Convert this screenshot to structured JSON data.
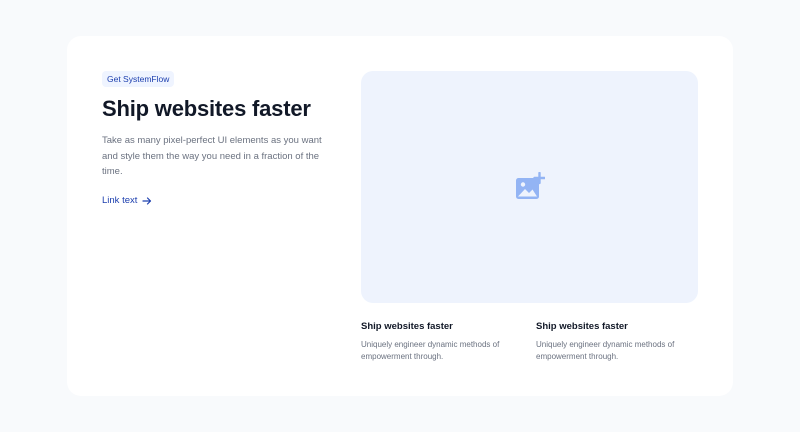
{
  "hero": {
    "badge": "Get SystemFlow",
    "title": "Ship websites faster",
    "description": "Take as many pixel-perfect UI elements as you want and style them the way you need in a fraction of the time.",
    "link_text": "Link text",
    "link_icon": "arrow-right-icon",
    "image_icon": "image-add-icon"
  },
  "features": [
    {
      "title": "Ship websites faster",
      "description": "Uniquely engineer dynamic methods of empowerment through."
    },
    {
      "title": "Ship websites faster",
      "description": "Uniquely engineer dynamic methods of empowerment through."
    }
  ],
  "colors": {
    "page_background": "#f8fafc",
    "card_background": "#ffffff",
    "accent": "#1e40af",
    "badge_background": "#eff4ff",
    "image_background": "#eef3fd",
    "icon": "#93b4f4"
  }
}
